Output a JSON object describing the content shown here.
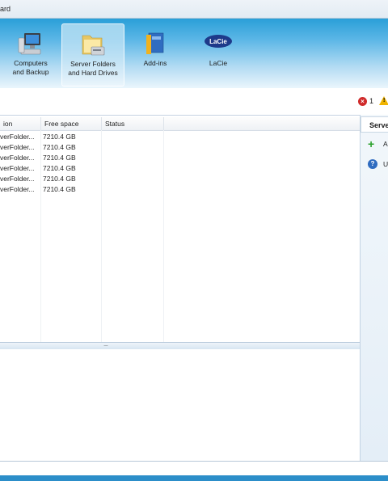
{
  "window": {
    "title_fragment": "ard"
  },
  "nav": [
    {
      "label_line1": "Computers",
      "label_line2": "and Backup",
      "icon": "computer-icon",
      "selected": false
    },
    {
      "label_line1": "Server Folders",
      "label_line2": "and Hard Drives",
      "icon": "folder-icon",
      "selected": true
    },
    {
      "label_line1": "Add-ins",
      "label_line2": "",
      "icon": "addins-book-icon",
      "selected": false
    },
    {
      "label_line1": "LaCie",
      "label_line2": "",
      "icon": "lacie-logo-icon",
      "selected": false
    }
  ],
  "alerts": {
    "critical_count": "1"
  },
  "grid": {
    "columns": [
      "ion",
      "Free space",
      "Status"
    ],
    "rows": [
      {
        "location": "verFolder...",
        "free": "7210.4 GB",
        "status": ""
      },
      {
        "location": "verFolder...",
        "free": "7210.4 GB",
        "status": ""
      },
      {
        "location": "verFolder...",
        "free": "7210.4 GB",
        "status": ""
      },
      {
        "location": "verFolder...",
        "free": "7210.4 GB",
        "status": ""
      },
      {
        "location": "verFolder...",
        "free": "7210.4 GB",
        "status": ""
      },
      {
        "location": "verFolder...",
        "free": "7210.4 GB",
        "status": ""
      }
    ]
  },
  "taskpane": {
    "title": "Serve",
    "tasks": [
      {
        "label": "A",
        "icon": "add-icon"
      },
      {
        "label": "U",
        "icon": "help-icon"
      }
    ]
  },
  "colors": {
    "ribbon_top": "#2a9fd8",
    "ribbon_bottom": "#eaf5fc",
    "accent": "#2c8ec9"
  }
}
